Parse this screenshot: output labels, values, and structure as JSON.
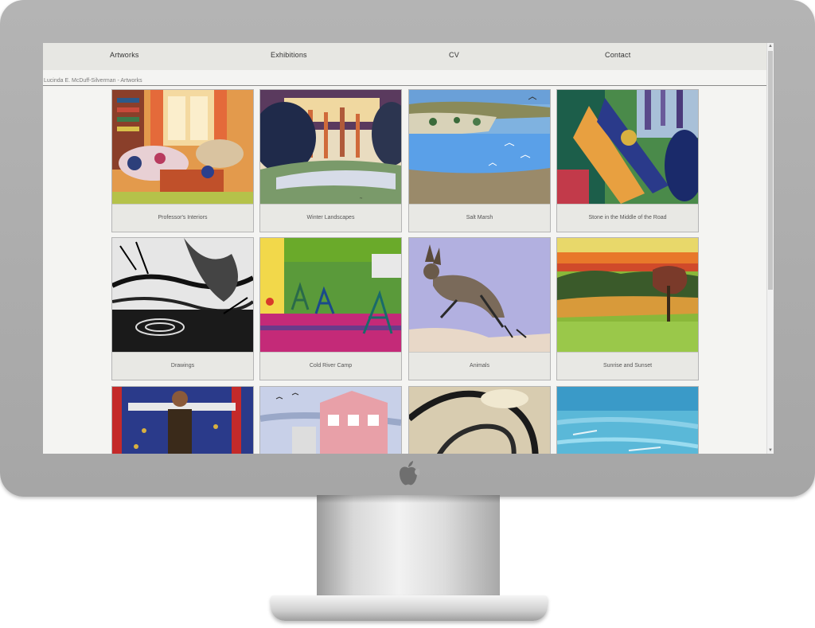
{
  "nav": {
    "items": [
      {
        "label": "Artworks"
      },
      {
        "label": "Exhibitions"
      },
      {
        "label": "CV"
      },
      {
        "label": "Contact"
      }
    ]
  },
  "breadcrumb": "Lucinda E. McDuff-Silverman - Artworks",
  "gallery": [
    {
      "title": "Professor's Interiors"
    },
    {
      "title": "Winter Landscapes"
    },
    {
      "title": "Salt Marsh"
    },
    {
      "title": "Stone in the Middle of the Road"
    },
    {
      "title": "Drawings"
    },
    {
      "title": "Cold River Camp"
    },
    {
      "title": "Animals"
    },
    {
      "title": "Sunrise and Sunset"
    },
    {
      "title": ""
    },
    {
      "title": ""
    },
    {
      "title": ""
    },
    {
      "title": ""
    }
  ],
  "colors": {
    "monitor": "#a9a9a9",
    "nav_bg": "#e7e7e3",
    "page_bg": "#f4f4f2",
    "caption_bg": "#e8e8e4"
  },
  "icons": [
    "apple-logo-icon",
    "scroll-up-arrow-icon",
    "scroll-down-arrow-icon"
  ]
}
